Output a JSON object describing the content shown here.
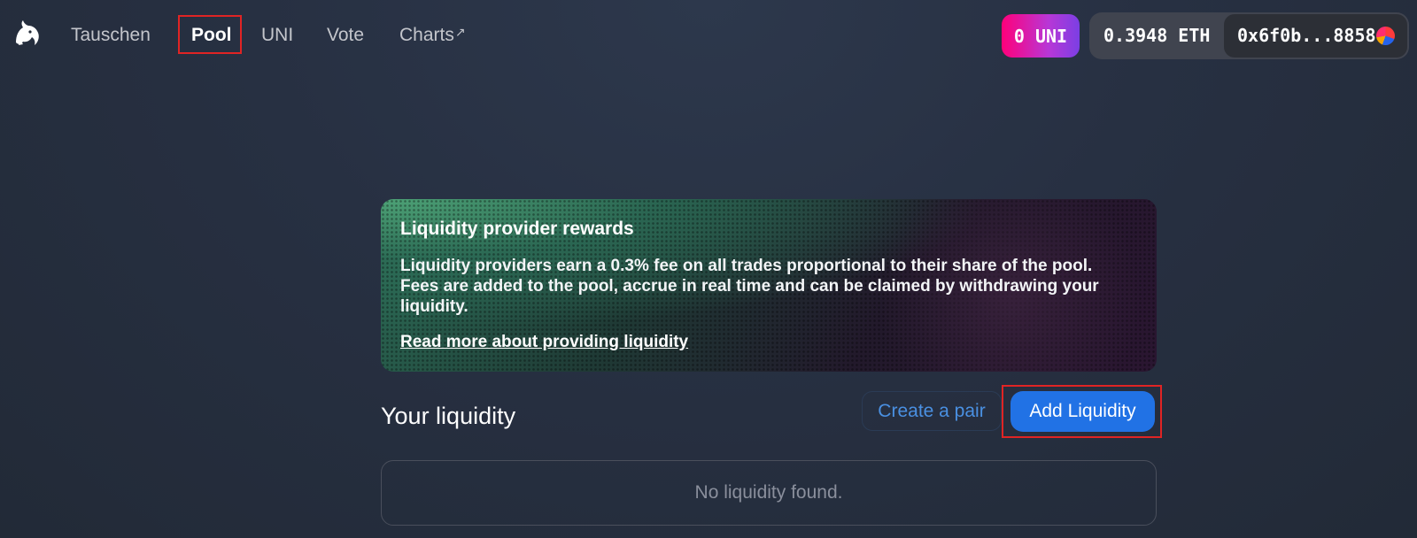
{
  "nav": {
    "items": [
      {
        "label": "Tauschen"
      },
      {
        "label": "Pool"
      },
      {
        "label": "UNI"
      },
      {
        "label": "Vote"
      },
      {
        "label": "Charts",
        "external_icon": "↗"
      }
    ]
  },
  "header": {
    "uni_balance": "0 UNI",
    "eth_balance": "0.3948 ETH",
    "address": "0x6f0b...8858"
  },
  "rewards": {
    "title": "Liquidity provider rewards",
    "description": "Liquidity providers earn a 0.3% fee on all trades proportional to their share of the pool. Fees are added to the pool, accrue in real time and can be claimed by withdrawing your liquidity.",
    "link": "Read more about providing liquidity"
  },
  "liquidity": {
    "title": "Your liquidity",
    "create_pair_label": "Create a pair",
    "add_liquidity_label": "Add Liquidity",
    "empty_text": "No liquidity found."
  },
  "colors": {
    "accent_blue": "#2172e5",
    "highlight_red": "#e02424",
    "uni_pink": "#ff007a"
  }
}
